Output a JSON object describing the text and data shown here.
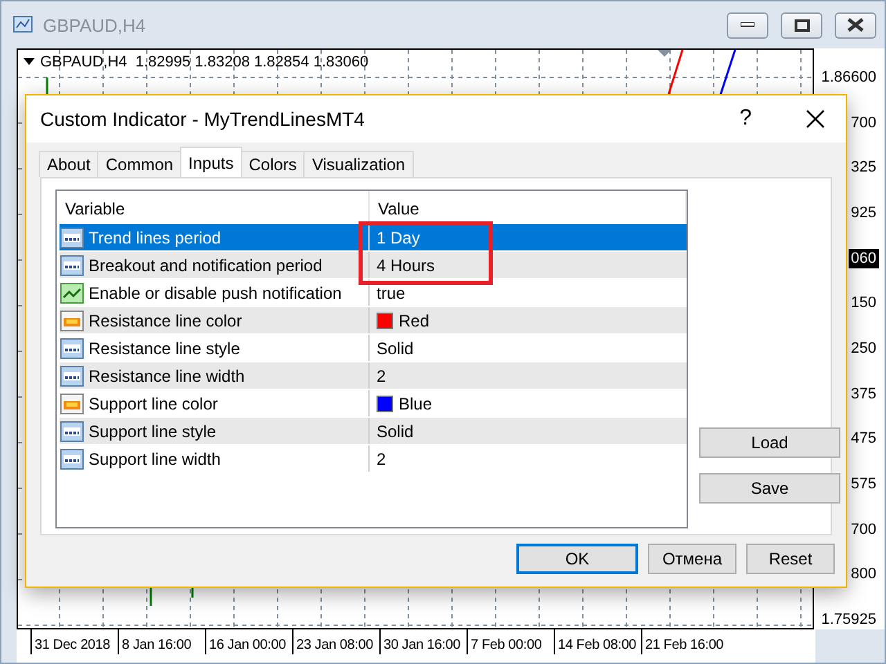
{
  "window": {
    "title": "GBPAUD,H4"
  },
  "chart": {
    "symbol_info": "GBPAUD,H4  1.82995 1.83208 1.82854 1.83060",
    "price_labels": [
      {
        "text": "1.86600",
        "current": false
      },
      {
        "text": "700",
        "current": false
      },
      {
        "text": "325",
        "current": false
      },
      {
        "text": "925",
        "current": false
      },
      {
        "text": "060",
        "current": true
      },
      {
        "text": "150",
        "current": false
      },
      {
        "text": "250",
        "current": false
      },
      {
        "text": "375",
        "current": false
      },
      {
        "text": "475",
        "current": false
      },
      {
        "text": "575",
        "current": false
      },
      {
        "text": "700",
        "current": false
      },
      {
        "text": "800",
        "current": false
      },
      {
        "text": "1.75925",
        "current": false
      }
    ],
    "time_labels": [
      "31 Dec 2018",
      "8 Jan 16:00",
      "16 Jan 00:00",
      "23 Jan 08:00",
      "30 Jan 16:00",
      "7 Feb 00:00",
      "14 Feb 08:00",
      "21 Feb 16:00"
    ]
  },
  "dialog": {
    "title": "Custom Indicator - MyTrendLinesMT4",
    "help": "?",
    "tabs": [
      {
        "label": "About",
        "selected": false
      },
      {
        "label": "Common",
        "selected": false
      },
      {
        "label": "Inputs",
        "selected": true
      },
      {
        "label": "Colors",
        "selected": false
      },
      {
        "label": "Visualization",
        "selected": false
      }
    ],
    "table": {
      "columns": [
        "Variable",
        "Value"
      ],
      "rows": [
        {
          "kind": "number",
          "variable": "Trend lines period",
          "value": "1 Day",
          "selected": true,
          "highlighted": true
        },
        {
          "kind": "number",
          "variable": "Breakout and notification period",
          "value": "4 Hours",
          "selected": false,
          "highlighted": true
        },
        {
          "kind": "bool",
          "variable": "Enable or disable push notification",
          "value": "true",
          "selected": false,
          "highlighted": false
        },
        {
          "kind": "color",
          "variable": "Resistance line color",
          "value": "Red",
          "color": "#ff0000",
          "selected": false,
          "highlighted": false
        },
        {
          "kind": "number",
          "variable": "Resistance line style",
          "value": "Solid",
          "selected": false,
          "highlighted": false
        },
        {
          "kind": "number",
          "variable": "Resistance line width",
          "value": "2",
          "selected": false,
          "highlighted": false
        },
        {
          "kind": "color",
          "variable": "Support line color",
          "value": "Blue",
          "color": "#0000ff",
          "selected": false,
          "highlighted": false
        },
        {
          "kind": "number",
          "variable": "Support line style",
          "value": "Solid",
          "selected": false,
          "highlighted": false
        },
        {
          "kind": "number",
          "variable": "Support line width",
          "value": "2",
          "selected": false,
          "highlighted": false
        }
      ]
    },
    "side_buttons": [
      "Load",
      "Save"
    ],
    "buttons": [
      {
        "label": "OK",
        "default": true
      },
      {
        "label": "Отмена",
        "default": false
      },
      {
        "label": "Reset",
        "default": false
      }
    ]
  }
}
